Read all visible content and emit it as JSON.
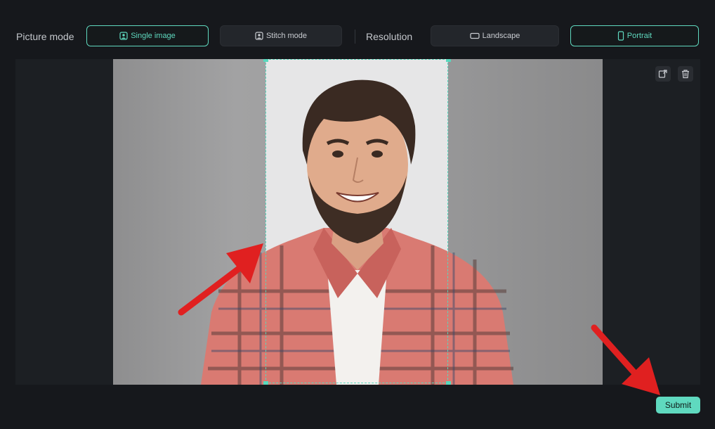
{
  "toolbar": {
    "picture_mode_label": "Picture mode",
    "single_image_label": "Single image",
    "stitch_mode_label": "Stitch mode",
    "resolution_label": "Resolution",
    "landscape_label": "Landscape",
    "portrait_label": "Portrait",
    "selected_mode": "Single image",
    "selected_resolution": "Portrait"
  },
  "canvas": {
    "subject": "smiling bearded man in red plaid shirt",
    "crop_aspect": "portrait"
  },
  "canvas_tools": {
    "replace_icon": "replace-image-icon",
    "delete_icon": "trash-icon"
  },
  "footer": {
    "submit_label": "Submit"
  },
  "colors": {
    "accent": "#5fd9bf",
    "background": "#16181c",
    "annotation_arrow": "#e02020"
  }
}
